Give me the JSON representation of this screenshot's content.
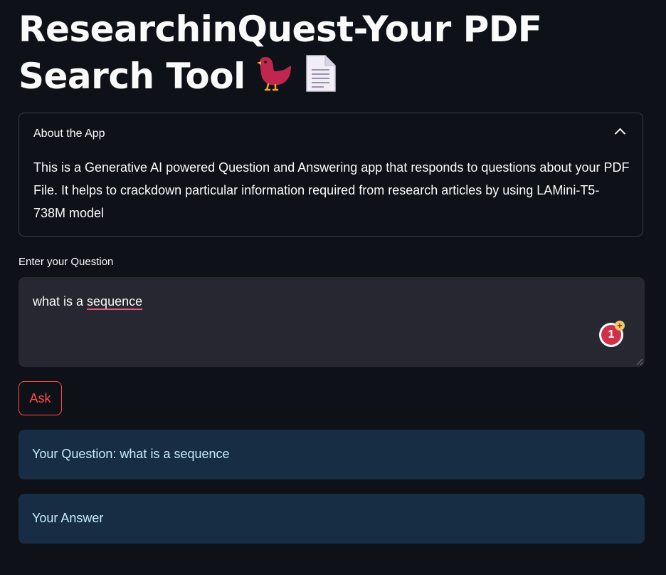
{
  "header": {
    "title": "ResearchinQuest-Your PDF Search Tool"
  },
  "about": {
    "title": "About the App",
    "body": "This is a Generative AI powered Question and Answering app that responds to questions about your PDF File. It helps to crackdown particular information required from research articles by using LAMini-T5-738M model"
  },
  "question_input": {
    "label": "Enter your Question",
    "value_prefix": "what is a ",
    "value_flagged": "sequence",
    "badge_count": "1",
    "badge_plus": "+"
  },
  "ask_button": {
    "label": "Ask"
  },
  "results": {
    "question_line": "Your Question: what is a sequence",
    "answer_line": "Your Answer"
  },
  "colors": {
    "background": "#0e1117",
    "accent": "#ff4b4b",
    "info_background": "#172d43",
    "info_text": "#c7ebff"
  },
  "icons": [
    "bird-icon",
    "document-icon",
    "chevron-up-icon",
    "grammar-badge-icon",
    "resize-grip-icon"
  ]
}
